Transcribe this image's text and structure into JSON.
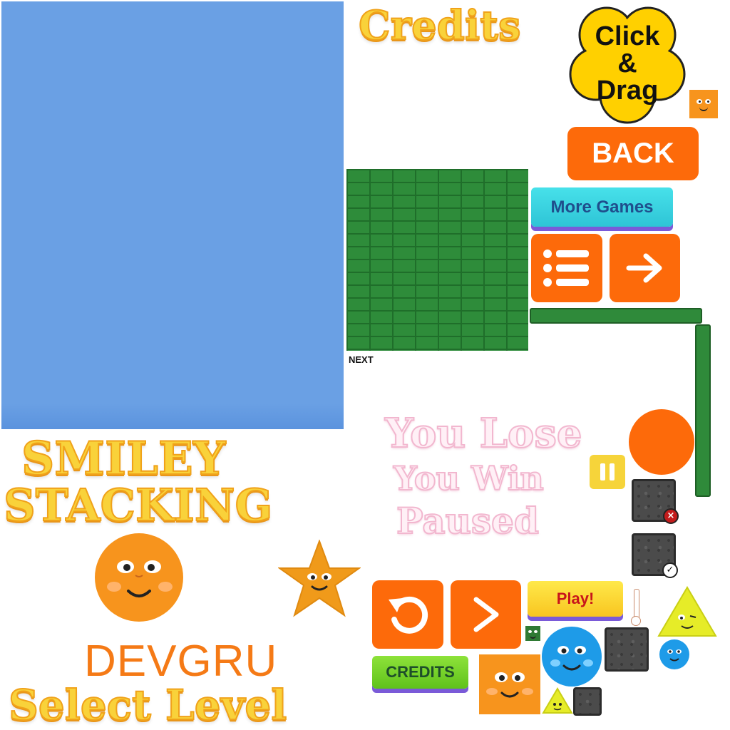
{
  "texts": {
    "credits_title": "Credits",
    "click_drag": [
      "Click",
      "&",
      "Drag"
    ],
    "back": "BACK",
    "more_games": "More Games",
    "next": "NEXT",
    "you_lose": "You Lose",
    "you_win": "You Win",
    "paused": "Paused",
    "smiley": "SMILEY",
    "stacking": "STACKING",
    "devgru": "DEVGRU",
    "select_level": "Select Level",
    "play": "Play!",
    "credits_btn": "CREDITS"
  },
  "icons": {
    "menu": "list-icon",
    "next": "arrow-right-icon",
    "restart": "restart-icon",
    "play": "play-icon",
    "pause": "pause-icon",
    "close": "close-icon",
    "check": "check-icon"
  },
  "colors": {
    "sky": "#6aa0e4",
    "orange": "#fd6a0a",
    "brick": "#2e8c3a",
    "yellow": "#f9d23a",
    "teal": "#3dd4e0",
    "lime": "#7ed321",
    "blue_smiley": "#1e9be8",
    "stone": "#4b4b4b"
  }
}
